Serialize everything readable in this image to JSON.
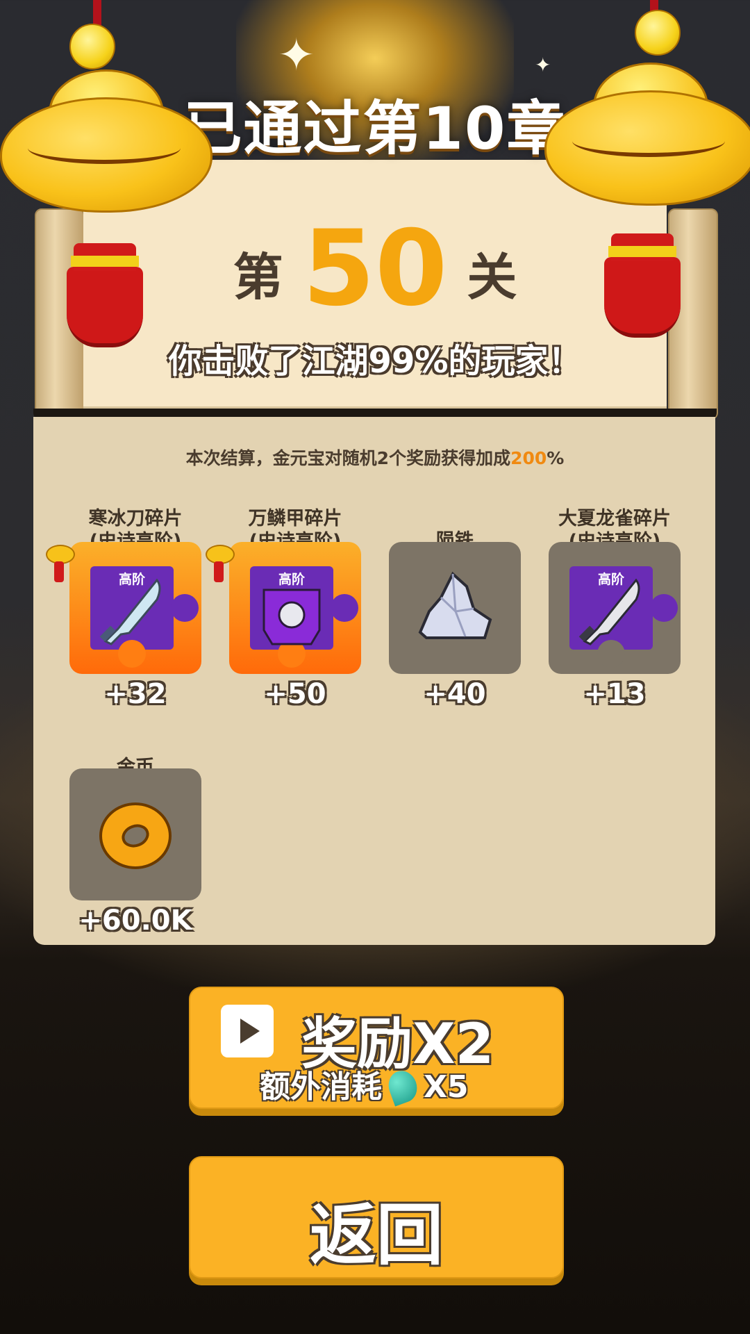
{
  "header": {
    "chapter_title": "已通过第10章"
  },
  "level": {
    "prefix": "第",
    "number": "50",
    "suffix": "关"
  },
  "defeat_message": "你击败了江湖99%的玩家！",
  "bonus": {
    "text": "本次结算，金元宝对随机2个奖励获得加成",
    "percent": "200",
    "percent_sign": "%"
  },
  "rewards": [
    {
      "name": "寒冰刀碎片\n(史诗高阶)",
      "tag": "高阶",
      "count": "+32",
      "icon": "ice-blade-icon",
      "boosted": true
    },
    {
      "name": "万鳞甲碎片\n(史诗高阶)",
      "tag": "高阶",
      "count": "+50",
      "icon": "scale-armor-icon",
      "boosted": true
    },
    {
      "name": "陨铁",
      "count": "+40",
      "icon": "meteor-iron-icon",
      "boosted": false
    },
    {
      "name": "大夏龙雀碎片\n(史诗高阶)",
      "tag": "高阶",
      "count": "+13",
      "icon": "dragon-sabre-icon",
      "boosted": false
    },
    {
      "name": "金币",
      "count": "+60.0K",
      "icon": "gold-coin-icon",
      "boosted": false
    }
  ],
  "buttons": {
    "double_label": "奖励X2",
    "double_cost_text": "额外消耗",
    "double_cost_amount": "X5",
    "back_label": "返回"
  },
  "colors": {
    "accent": "#fbb225",
    "highlight": "#f08a12",
    "panel": "#e3d3b2"
  }
}
